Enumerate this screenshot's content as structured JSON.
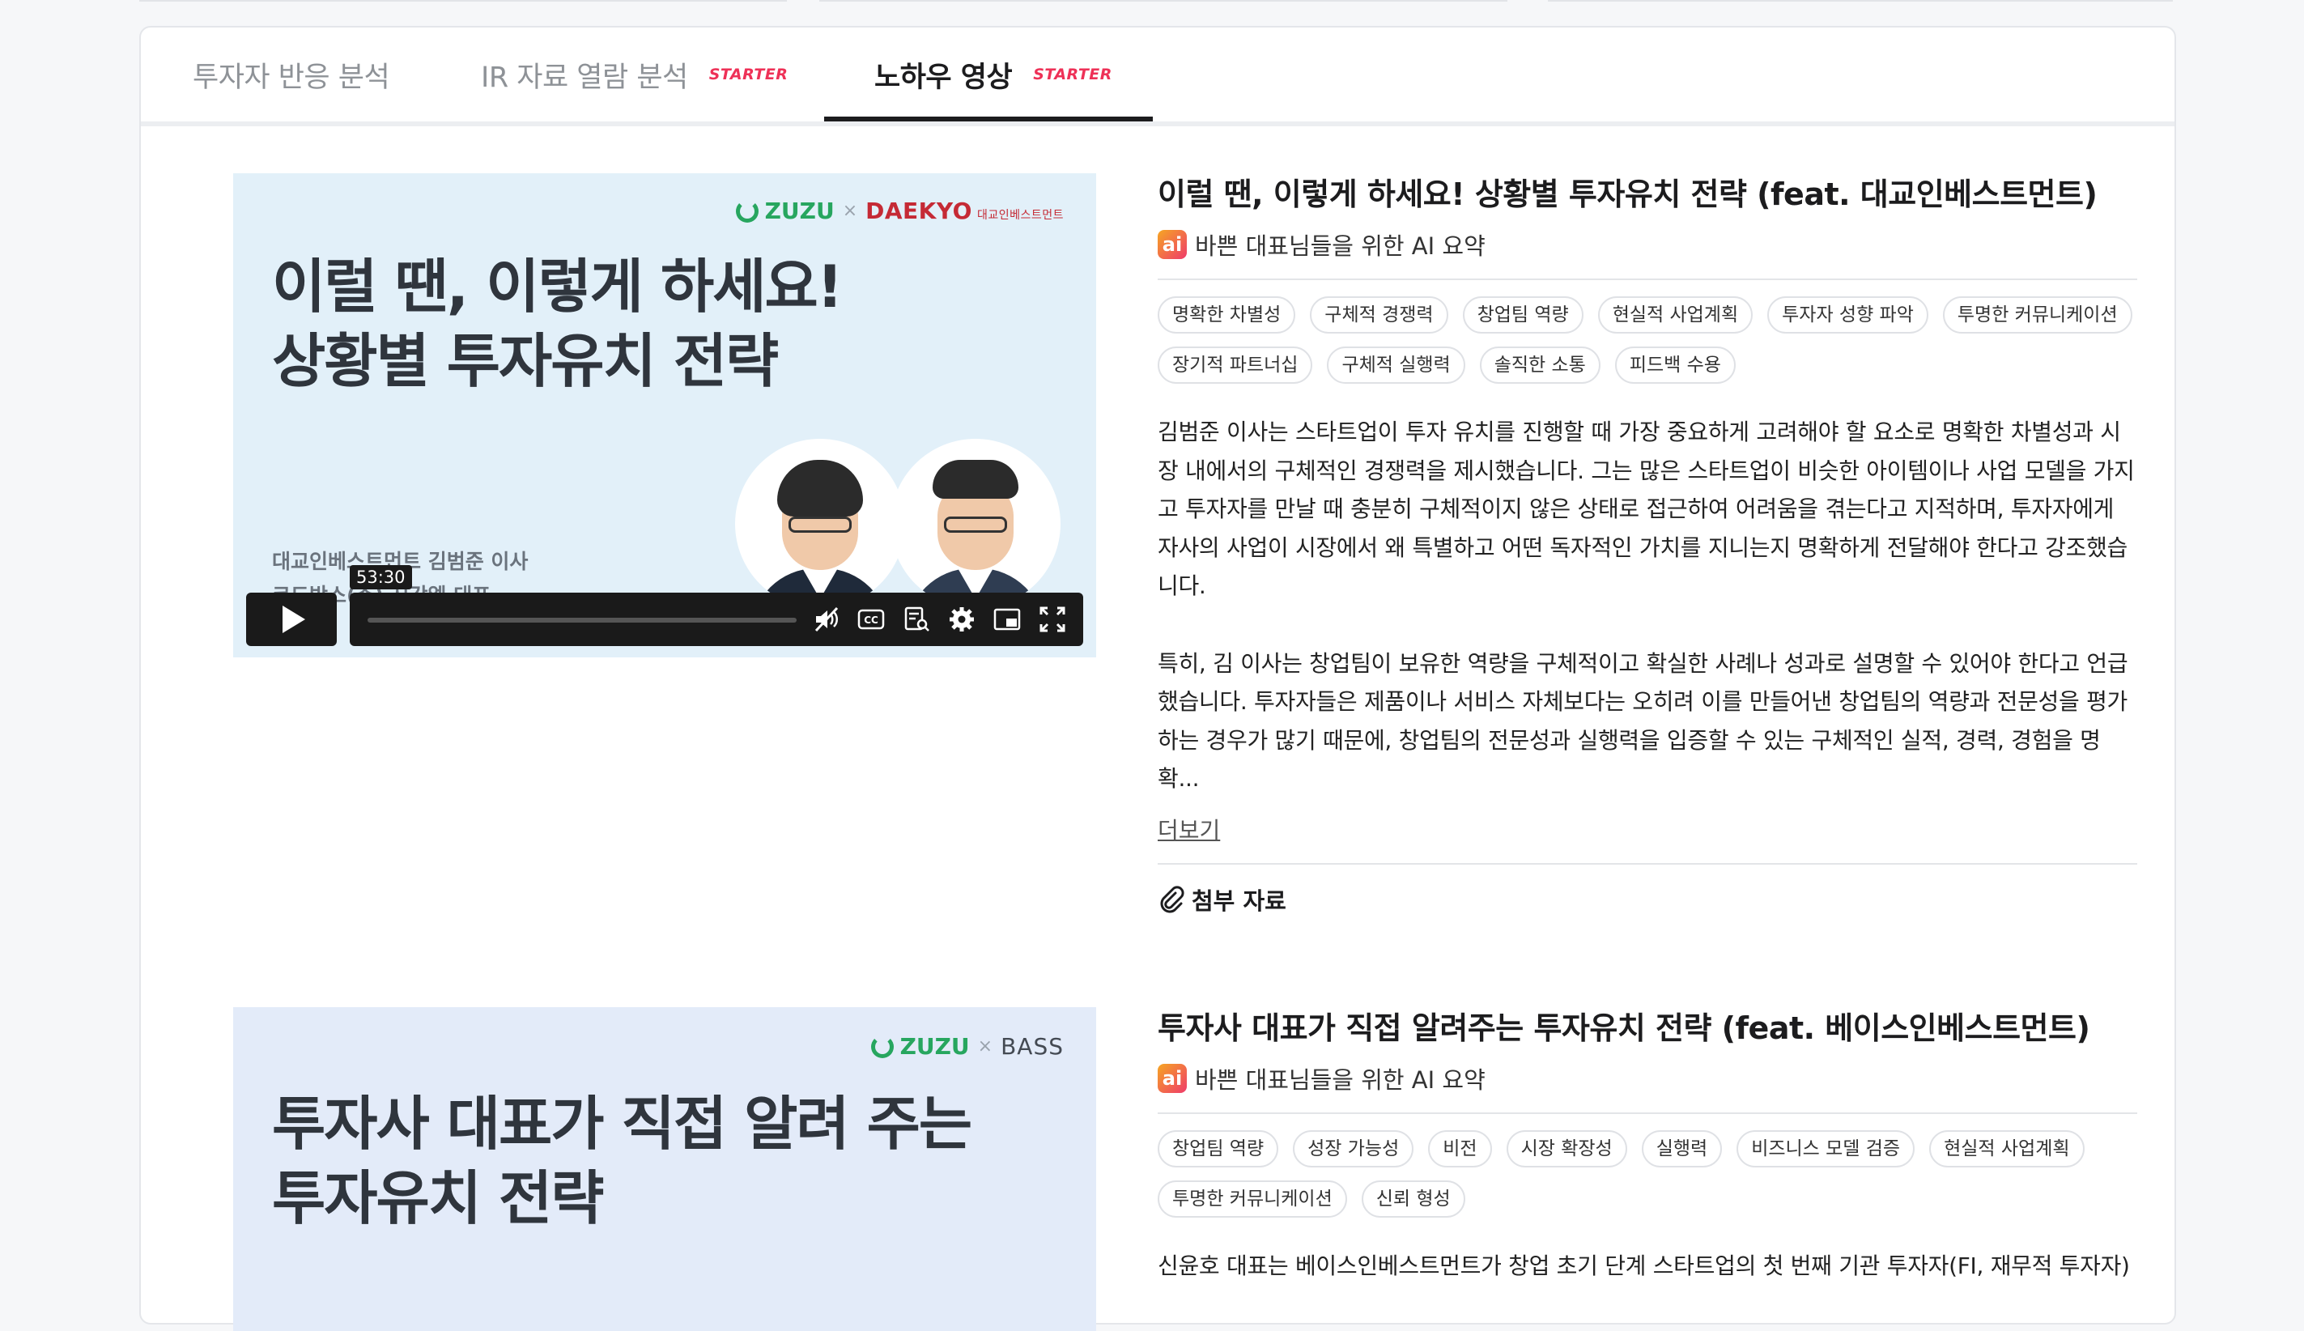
{
  "tabs": [
    {
      "label": "투자자 반응 분석",
      "badge": ""
    },
    {
      "label": "IR 자료 열람 분석",
      "badge": "STARTER"
    },
    {
      "label": "노하우 영상",
      "badge": "STARTER"
    }
  ],
  "posts": [
    {
      "title": "이럴 땐, 이렇게 하세요! 상황별 투자유치 전략 (feat. 대교인베스트먼트)",
      "thumbnail": {
        "logo_main": "ZUZU",
        "logo_sep": "×",
        "logo_partner": "DAEKYO",
        "logo_partner_sub": "대교인베스트먼트",
        "title_line1": "이럴 땐, 이렇게 하세요!",
        "title_line2": "상황별 투자유치 전략",
        "caption1": "대교인베스트먼트 김범준 이사",
        "caption2": "코드박스(주) 시강엘 대표"
      },
      "video": {
        "duration": "53:30",
        "progress": 0
      },
      "ai_label": "바쁜 대표님들을 위한 AI 요약",
      "tags": [
        "명확한 차별성",
        "구체적 경쟁력",
        "창업팀 역량",
        "현실적 사업계획",
        "투자자 성향 파악",
        "투명한 커뮤니케이션",
        "장기적 파트너십",
        "구체적 실행력",
        "솔직한 소통",
        "피드백 수용"
      ],
      "summary_p1": "김범준 이사는 스타트업이 투자 유치를 진행할 때 가장 중요하게 고려해야 할 요소로 명확한 차별성과 시장 내에서의 구체적인 경쟁력을 제시했습니다. 그는 많은 스타트업이 비슷한 아이템이나 사업 모델을 가지고 투자자를 만날 때 충분히 구체적이지 않은 상태로 접근하여 어려움을 겪는다고 지적하며, 투자자에게 자사의 사업이 시장에서 왜 특별하고 어떤 독자적인 가치를 지니는지 명확하게 전달해야 한다고 강조했습니다.",
      "summary_p2": "특히, 김 이사는 창업팀이 보유한 역량을 구체적이고 확실한 사례나 성과로 설명할 수 있어야 한다고 언급했습니다. 투자자들은 제품이나 서비스 자체보다는 오히려 이를 만들어낸 창업팀의 역량과 전문성을 평가하는 경우가 많기 때문에, 창업팀의 전문성과 실행력을 입증할 수 있는 구체적인 실적, 경력, 경험을 명확...",
      "more_label": "더보기",
      "attach_label": "첨부 자료"
    },
    {
      "title": "투자사 대표가 직접 알려주는 투자유치 전략 (feat. 베이스인베스트먼트)",
      "thumbnail": {
        "logo_main": "ZUZU",
        "logo_sep": "×",
        "logo_partner": "BASS",
        "title_line1": "투자사 대표가 직접 알려 주는",
        "title_line2": "투자유치 전략"
      },
      "ai_label": "바쁜 대표님들을 위한 AI 요약",
      "tags": [
        "창업팀 역량",
        "성장 가능성",
        "비전",
        "시장 확장성",
        "실행력",
        "비즈니스 모델 검증",
        "현실적 사업계획",
        "투명한 커뮤니케이션",
        "신뢰 형성"
      ],
      "summary_p1": "신윤호 대표는 베이스인베스트먼트가 창업 초기 단계 스타트업의 첫 번째 기관 투자자(FI, 재무적 투자자)"
    }
  ],
  "colors": {
    "accent_badge": "#ee3157",
    "zuzu_green": "#27a65f",
    "daekyo_red": "#c52a35",
    "active_tab": "#1c1c1e"
  }
}
